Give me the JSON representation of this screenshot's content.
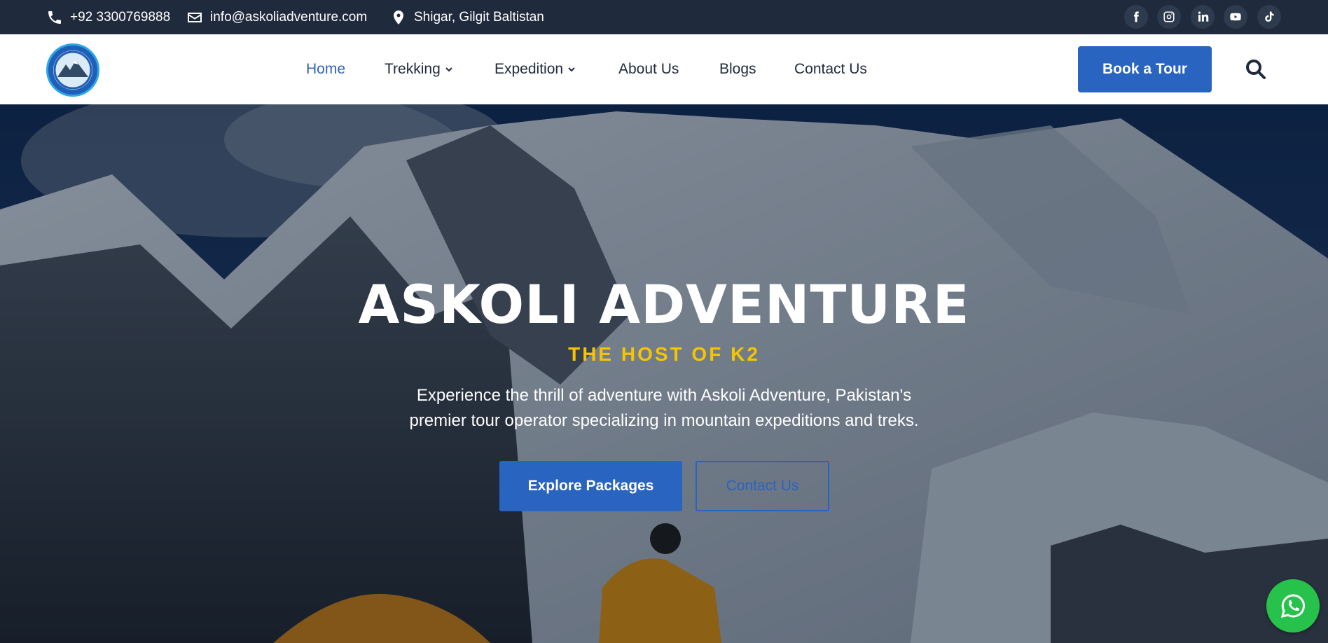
{
  "topbar": {
    "phone": "+92 3300769888",
    "email": "info@askoliadventure.com",
    "location": "Shigar, Gilgit Baltistan",
    "social": [
      "facebook-icon",
      "instagram-icon",
      "linkedin-icon",
      "youtube-icon",
      "tiktok-icon"
    ]
  },
  "nav": {
    "items": [
      {
        "label": "Home",
        "active": true
      },
      {
        "label": "Trekking",
        "dropdown": true
      },
      {
        "label": "Expedition",
        "dropdown": true
      },
      {
        "label": "About Us"
      },
      {
        "label": "Blogs"
      },
      {
        "label": "Contact Us"
      }
    ],
    "cta": "Book a Tour"
  },
  "hero": {
    "title": "ASKOLI ADVENTURE",
    "subtitle": "THE HOST OF K2",
    "description_line1": "Experience the thrill of adventure with Askoli Adventure, Pakistan's",
    "description_line2": "premier tour operator specializing in mountain expeditions and treks.",
    "primary_button": "Explore Packages",
    "secondary_button": "Contact Us"
  },
  "colors": {
    "topbar": "#1f2a3c",
    "brand_blue": "#2864c0",
    "accent_yellow": "#f6c500",
    "whatsapp_green": "#27c24c"
  }
}
